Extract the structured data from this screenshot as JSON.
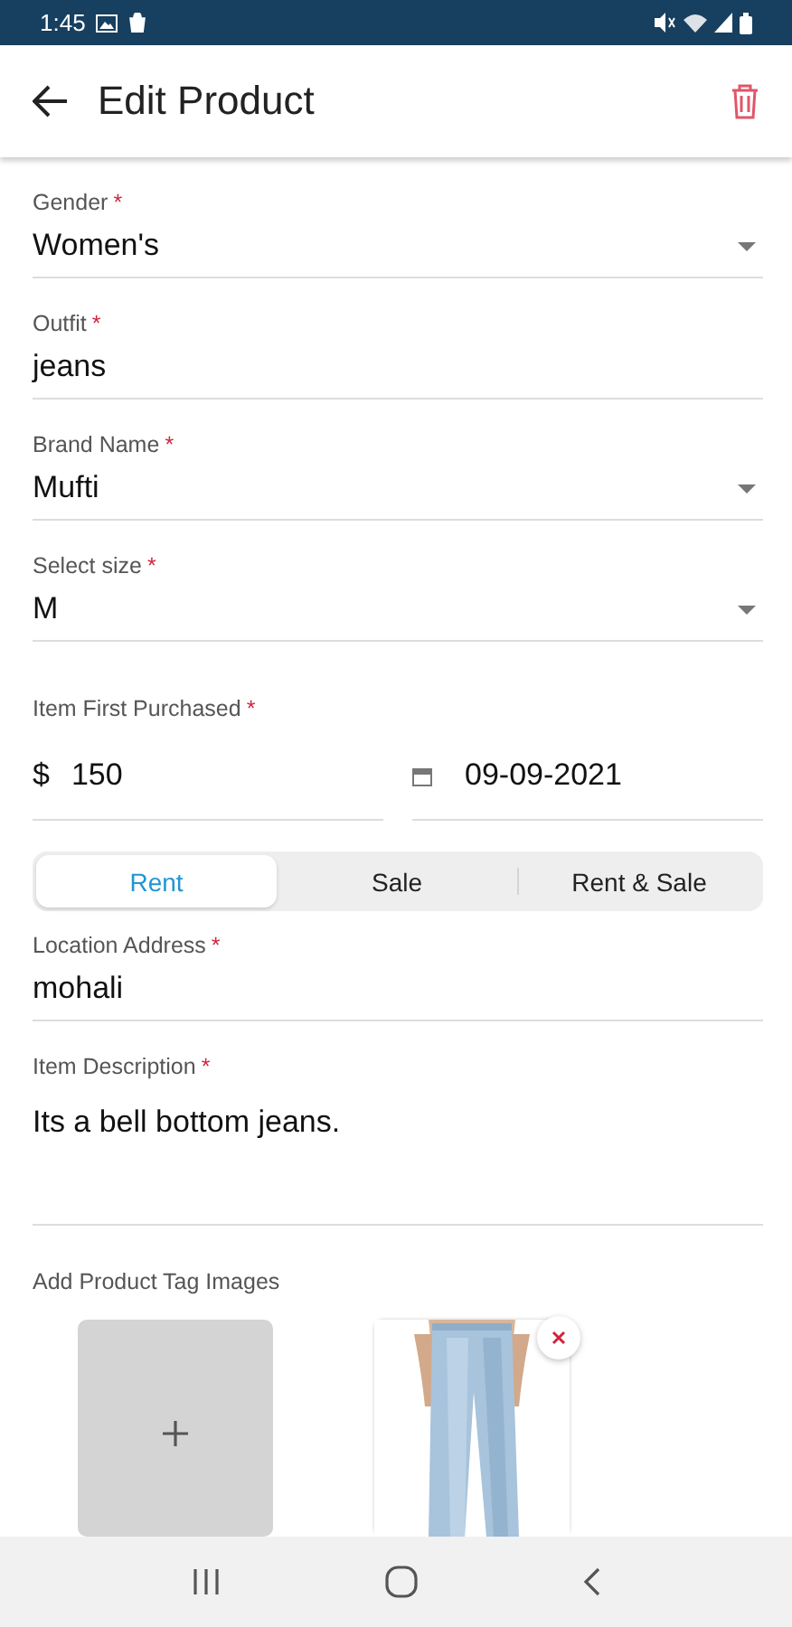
{
  "status_bar": {
    "time": "1:45"
  },
  "app_bar": {
    "title": "Edit Product"
  },
  "fields": [
    {
      "kind": "dropdown",
      "label": "Gender",
      "required_mark": "*",
      "value": "Women's"
    },
    {
      "kind": "text",
      "label": "Outfit",
      "required_mark": "*",
      "value": "jeans"
    },
    {
      "kind": "dropdown",
      "label": "Brand Name",
      "required_mark": "*",
      "value": "Mufti"
    },
    {
      "kind": "dropdown",
      "label": "Select size",
      "required_mark": "*",
      "value": "M"
    }
  ],
  "purchase": {
    "label": "Item First Purchased",
    "required_mark": "*",
    "currency": "$",
    "price": "150",
    "date": "09-09-2021"
  },
  "listing_type": [
    {
      "label": "Rent",
      "selected": true
    },
    {
      "label": "Sale",
      "selected": false
    },
    {
      "label": "Rent & Sale",
      "selected": false
    }
  ],
  "location": {
    "label": "Location Address",
    "required_mark": "*",
    "value": "mohali"
  },
  "description": {
    "label": "Item Description",
    "required_mark": "*",
    "value": "Its a bell bottom jeans."
  },
  "tag_images": {
    "label": "Add Product Tag Images",
    "images": [
      {
        "kind": "add"
      },
      {
        "kind": "picture"
      }
    ]
  }
}
